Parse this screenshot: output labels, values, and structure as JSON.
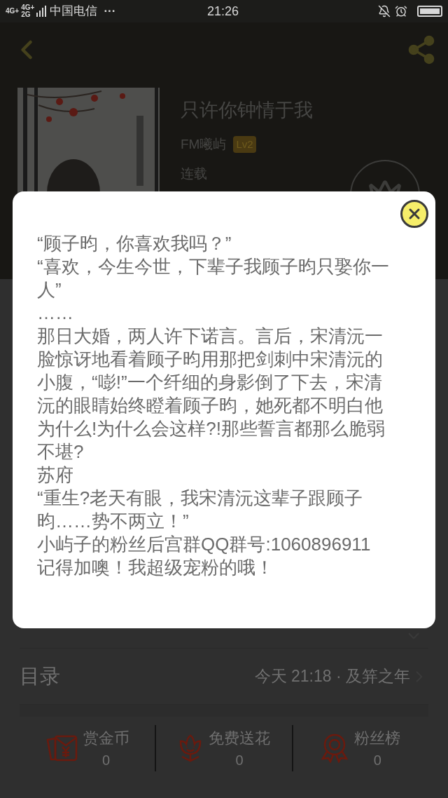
{
  "status_bar": {
    "network": [
      "4G+",
      "4G+",
      "2G"
    ],
    "carrier": "中国电信",
    "more": "···",
    "time": "21:26"
  },
  "book": {
    "title": "只许你钟情于我",
    "author": "FM曦屿",
    "level_badge": "Lv2",
    "status": "连载"
  },
  "dialog": {
    "lines": [
      "“顾子昀，你喜欢我吗？”",
      "“喜欢，今生今世，下辈子我顾子昀只娶你一人”",
      "……",
      "那日大婚，两人许下诺言。言后，宋清沅一脸惊讶地看着顾子昀用那把剑刺中宋清沅的小腹，“嘭!”一个纤细的身影倒了下去，宋清沅的眼睛始终瞪着顾子昀，她死都不明白他为什么!为什么会这样?!那些誓言都那么脆弱不堪?",
      "苏府",
      "“重生?老天有眼，我宋清沅这辈子跟顾子昀……势不两立！”",
      "小屿子的粉丝后宫群QQ群号:1060896911",
      "记得加噢！我超级宠粉的哦！"
    ]
  },
  "catalog": {
    "label": "目录",
    "latest": "今天 21:18 · 及笄之年"
  },
  "stats": [
    {
      "kind": "coins",
      "label": "赏金币",
      "count": "0"
    },
    {
      "kind": "flower",
      "label": "免费送花",
      "count": "0"
    },
    {
      "kind": "fans",
      "label": "粉丝榜",
      "count": "0"
    }
  ]
}
